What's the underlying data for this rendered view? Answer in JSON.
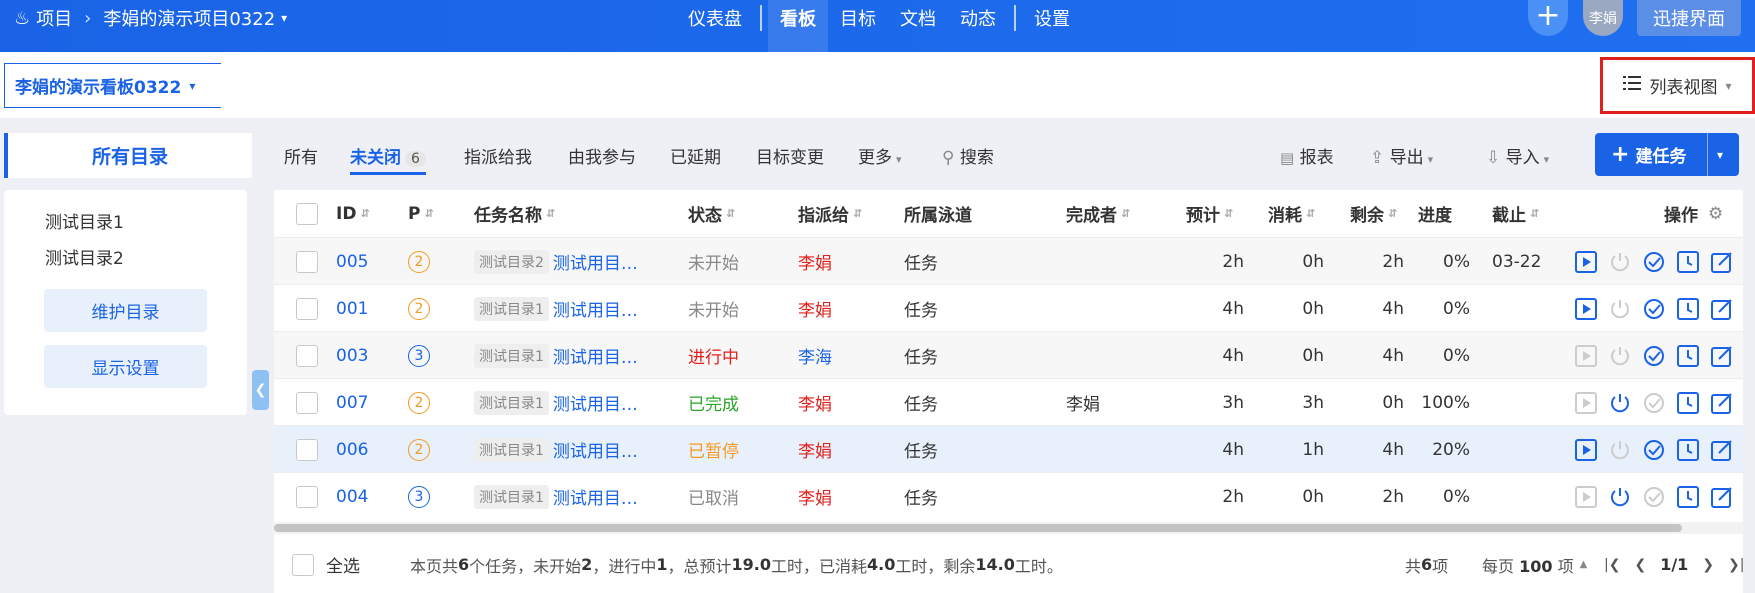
{
  "topbar": {
    "project_label": "项目",
    "project_name": "李娟的演示项目0322",
    "nav": [
      "仪表盘",
      "看板",
      "目标",
      "文档",
      "动态",
      "设置"
    ],
    "active_nav": "看板",
    "user": "李娟",
    "quick_ui": "迅捷界面"
  },
  "subbar": {
    "board_name": "李娟的演示看板0322",
    "view_label": "列表视图"
  },
  "sidebar": {
    "title": "所有目录",
    "dirs": [
      "测试目录1",
      "测试目录2"
    ],
    "maintain_btn": "维护目录",
    "display_btn": "显示设置"
  },
  "filters": {
    "all": "所有",
    "open": "未关闭",
    "open_count": "6",
    "assigned": "指派给我",
    "involved": "由我参与",
    "delayed": "已延期",
    "goal_changed": "目标变更",
    "more": "更多",
    "search": "搜索",
    "report": "报表",
    "export": "导出",
    "import": "导入",
    "new_task": "建任务"
  },
  "table": {
    "headers": {
      "id": "ID",
      "p": "P",
      "name": "任务名称",
      "status": "状态",
      "assignee": "指派给",
      "lane": "所属泳道",
      "finisher": "完成者",
      "estimate": "预计",
      "consumed": "消耗",
      "left": "剩余",
      "progress": "进度",
      "deadline": "截止",
      "ops": "操作"
    },
    "rows": [
      {
        "id": "005",
        "p": "2",
        "dir": "测试目录2",
        "name": "测试用目…",
        "status": "未开始",
        "assignee": "李娟",
        "lane": "任务",
        "finisher": "",
        "estimate": "2h",
        "consumed": "0h",
        "left": "2h",
        "progress": "0%",
        "deadline": "03-22"
      },
      {
        "id": "001",
        "p": "2",
        "dir": "测试目录1",
        "name": "测试用目…",
        "status": "未开始",
        "assignee": "李娟",
        "lane": "任务",
        "finisher": "",
        "estimate": "4h",
        "consumed": "0h",
        "left": "4h",
        "progress": "0%",
        "deadline": ""
      },
      {
        "id": "003",
        "p": "3",
        "dir": "测试目录1",
        "name": "测试用目…",
        "status": "进行中",
        "assignee": "李海",
        "lane": "任务",
        "finisher": "",
        "estimate": "4h",
        "consumed": "0h",
        "left": "4h",
        "progress": "0%",
        "deadline": ""
      },
      {
        "id": "007",
        "p": "2",
        "dir": "测试目录1",
        "name": "测试用目…",
        "status": "已完成",
        "assignee": "李娟",
        "lane": "任务",
        "finisher": "李娟",
        "estimate": "3h",
        "consumed": "3h",
        "left": "0h",
        "progress": "100%",
        "deadline": ""
      },
      {
        "id": "006",
        "p": "2",
        "dir": "测试目录1",
        "name": "测试用目…",
        "status": "已暂停",
        "assignee": "李娟",
        "lane": "任务",
        "finisher": "",
        "estimate": "4h",
        "consumed": "1h",
        "left": "4h",
        "progress": "20%",
        "deadline": ""
      },
      {
        "id": "004",
        "p": "3",
        "dir": "测试目录1",
        "name": "测试用目…",
        "status": "已取消",
        "assignee": "李娟",
        "lane": "任务",
        "finisher": "",
        "estimate": "2h",
        "consumed": "0h",
        "left": "2h",
        "progress": "0%",
        "deadline": ""
      }
    ]
  },
  "footer": {
    "select_all": "全选",
    "summary": [
      "本页共 ",
      "6",
      " 个任务，未开始 ",
      "2",
      "，进行中 ",
      "1",
      "，总预计 ",
      "19.0",
      " 工时，已消耗 ",
      "4.0",
      " 工时，剩余 ",
      "14.0",
      " 工时。"
    ],
    "total": [
      "共 ",
      "6",
      " 项"
    ],
    "per_page": [
      "每页 ",
      "100",
      " 项"
    ],
    "page": "1/1"
  },
  "colors": {
    "primary": "#1a63e6",
    "red": "#e0201c",
    "orange": "#f59a23",
    "green": "#2aa52a",
    "gray": "#888888"
  }
}
